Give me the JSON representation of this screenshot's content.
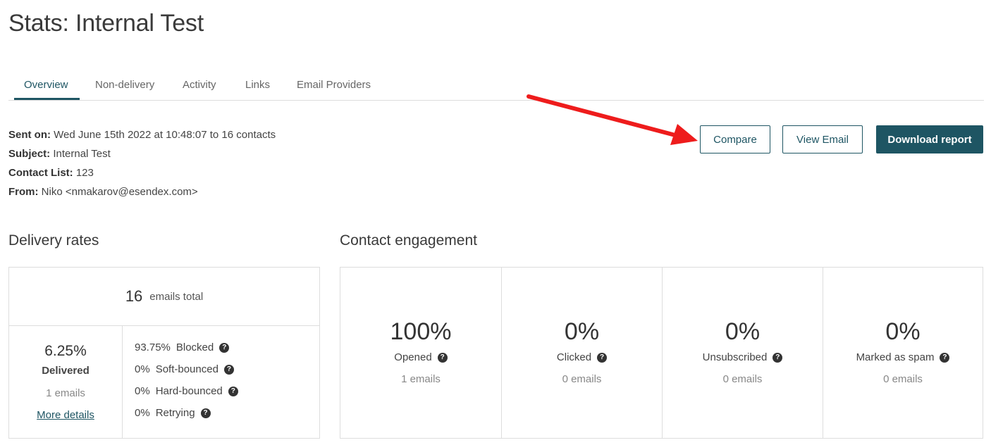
{
  "page": {
    "title": "Stats: Internal Test"
  },
  "tabs": [
    {
      "label": "Overview",
      "active": true
    },
    {
      "label": "Non-delivery",
      "active": false
    },
    {
      "label": "Activity",
      "active": false
    },
    {
      "label": "Links",
      "active": false
    },
    {
      "label": "Email Providers",
      "active": false
    }
  ],
  "meta": {
    "sent_on_label": "Sent on:",
    "sent_on_value": "Wed June 15th 2022 at 10:48:07 to 16 contacts",
    "subject_label": "Subject:",
    "subject_value": "Internal Test",
    "contact_list_label": "Contact List:",
    "contact_list_value": "123",
    "from_label": "From:",
    "from_value": "Niko <nmakarov@esendex.com>"
  },
  "actions": {
    "compare_label": "Compare",
    "view_email_label": "View Email",
    "download_report_label": "Download report"
  },
  "delivery": {
    "title": "Delivery rates",
    "total_value": "16",
    "total_label": "emails total",
    "delivered_pct": "6.25%",
    "delivered_label": "Delivered",
    "delivered_count": "1 emails",
    "more_details": "More details",
    "breakdown": [
      {
        "value": "93.75%",
        "label": "Blocked"
      },
      {
        "value": "0%",
        "label": "Soft-bounced"
      },
      {
        "value": "0%",
        "label": "Hard-bounced"
      },
      {
        "value": "0%",
        "label": "Retrying"
      }
    ]
  },
  "engagement": {
    "title": "Contact engagement",
    "metrics": [
      {
        "pct": "100%",
        "label": "Opened",
        "count": "1 emails"
      },
      {
        "pct": "0%",
        "label": "Clicked",
        "count": "0 emails"
      },
      {
        "pct": "0%",
        "label": "Unsubscribed",
        "count": "0 emails"
      },
      {
        "pct": "0%",
        "label": "Marked as spam",
        "count": "0 emails"
      }
    ]
  },
  "colors": {
    "accent": "#1e5563",
    "annotation_arrow": "#ee1c1c"
  },
  "icons": {
    "help": "question-circle-icon",
    "annotation": "red-arrow-annotation"
  }
}
